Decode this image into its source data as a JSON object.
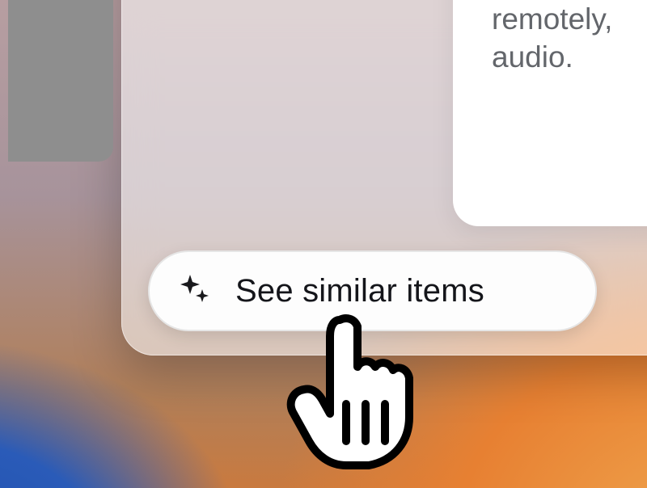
{
  "panel": {
    "text": "remotely, audio."
  },
  "pill": {
    "label": "See similar items",
    "icon": "sparkle-icon"
  },
  "cursor": {
    "name": "pointer-cursor"
  }
}
